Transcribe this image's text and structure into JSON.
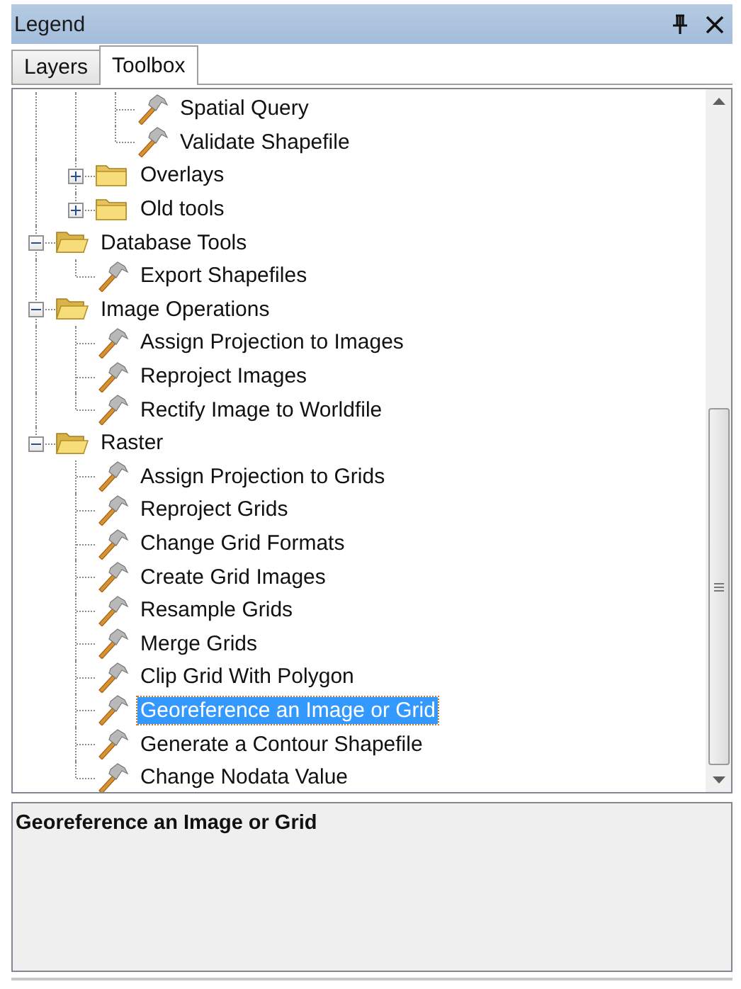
{
  "window": {
    "title": "Legend"
  },
  "tabs": [
    {
      "label": "Layers",
      "selected": false
    },
    {
      "label": "Toolbox",
      "selected": true
    }
  ],
  "tree": {
    "items": [
      {
        "children": [
          {
            "children": [
              {
                "kind": "tool",
                "label": "Spatial Query",
                "selected": false
              },
              {
                "kind": "tool",
                "label": "Validate Shapefile",
                "selected": false
              }
            ]
          },
          {
            "kind": "folder",
            "label": "Overlays",
            "expanded": false,
            "selected": false
          },
          {
            "kind": "folder",
            "label": "Old tools",
            "expanded": false,
            "selected": false
          }
        ]
      },
      {
        "kind": "folder",
        "label": "Database Tools",
        "expanded": true,
        "selected": false,
        "children": [
          {
            "kind": "tool",
            "label": "Export Shapefiles",
            "selected": false
          }
        ]
      },
      {
        "kind": "folder",
        "label": "Image Operations",
        "expanded": true,
        "selected": false,
        "children": [
          {
            "kind": "tool",
            "label": "Assign Projection to Images",
            "selected": false
          },
          {
            "kind": "tool",
            "label": "Reproject Images",
            "selected": false
          },
          {
            "kind": "tool",
            "label": "Rectify Image to Worldfile",
            "selected": false
          }
        ]
      },
      {
        "kind": "folder",
        "label": "Raster",
        "expanded": true,
        "selected": false,
        "children": [
          {
            "kind": "tool",
            "label": "Assign Projection to Grids",
            "selected": false
          },
          {
            "kind": "tool",
            "label": "Reproject Grids",
            "selected": false
          },
          {
            "kind": "tool",
            "label": "Change Grid Formats",
            "selected": false
          },
          {
            "kind": "tool",
            "label": "Create Grid Images",
            "selected": false
          },
          {
            "kind": "tool",
            "label": "Resample Grids",
            "selected": false
          },
          {
            "kind": "tool",
            "label": "Merge Grids",
            "selected": false
          },
          {
            "kind": "tool",
            "label": "Clip Grid With Polygon",
            "selected": false
          },
          {
            "kind": "tool",
            "label": "Georeference an Image or Grid",
            "selected": true
          },
          {
            "kind": "tool",
            "label": "Generate a Contour Shapefile",
            "selected": false
          },
          {
            "kind": "tool",
            "label": "Change Nodata Value",
            "selected": false
          }
        ]
      }
    ]
  },
  "description": {
    "title": "Georeference an Image or Grid"
  }
}
